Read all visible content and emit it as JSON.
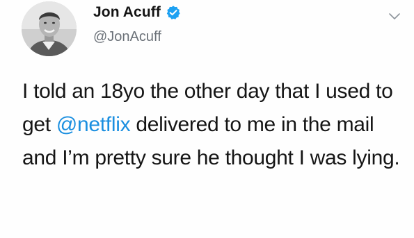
{
  "author": {
    "display_name": "Jon Acuff",
    "handle": "@JonAcuff",
    "verified": true,
    "avatar_icon": "profile-photo"
  },
  "tweet": {
    "part1": "I told an 18yo the other day that I used to get ",
    "mention": "@netflix",
    "part2": " delivered to me in the mail and I’m pretty sure he thought I was lying."
  },
  "colors": {
    "mention": "#1b8fe0",
    "verified_badge": "#1da1f2",
    "handle": "#6b7178"
  },
  "icons": {
    "verified": "verified-badge-icon",
    "menu": "chevron-down-icon"
  }
}
